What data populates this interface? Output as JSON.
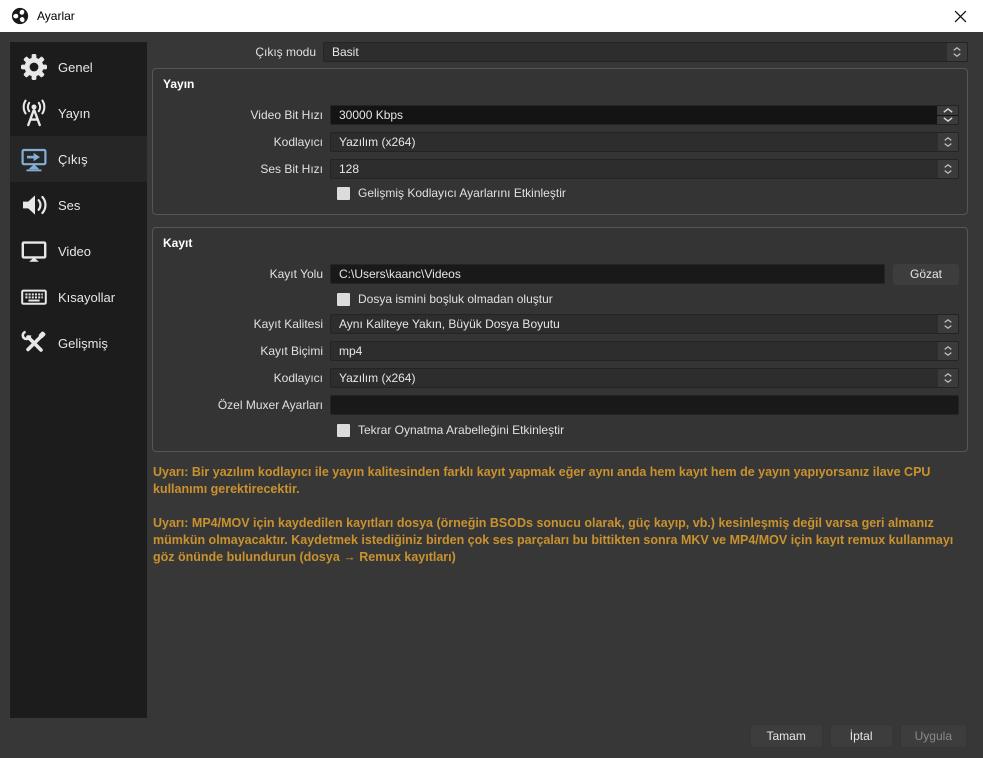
{
  "window": {
    "title": "Ayarlar"
  },
  "sidebar": {
    "items": [
      {
        "label": "Genel",
        "icon": "gear-icon"
      },
      {
        "label": "Yayın",
        "icon": "broadcast-icon"
      },
      {
        "label": "Çıkış",
        "icon": "output-icon",
        "selected": true
      },
      {
        "label": "Ses",
        "icon": "audio-icon"
      },
      {
        "label": "Video",
        "icon": "video-icon"
      },
      {
        "label": "Kısayollar",
        "icon": "keyboard-icon"
      },
      {
        "label": "Gelişmiş",
        "icon": "tools-icon"
      }
    ]
  },
  "output_mode": {
    "label": "Çıkış modu",
    "value": "Basit"
  },
  "streaming": {
    "title": "Yayın",
    "video_bitrate": {
      "label": "Video Bit Hızı",
      "value": "30000 Kbps"
    },
    "encoder": {
      "label": "Kodlayıcı",
      "value": "Yazılım (x264)"
    },
    "audio_bitrate": {
      "label": "Ses Bit Hızı",
      "value": "128"
    },
    "advanced_checkbox": "Gelişmiş Kodlayıcı Ayarlarını Etkinleştir"
  },
  "recording": {
    "title": "Kayıt",
    "path": {
      "label": "Kayıt Yolu",
      "value": "C:\\Users\\kaanc\\Videos",
      "browse": "Gözat"
    },
    "no_space_checkbox": "Dosya ismini boşluk olmadan oluştur",
    "quality": {
      "label": "Kayıt Kalitesi",
      "value": "Aynı Kaliteye Yakın, Büyük Dosya Boyutu"
    },
    "format": {
      "label": "Kayıt Biçimi",
      "value": "mp4"
    },
    "encoder": {
      "label": "Kodlayıcı",
      "value": "Yazılım (x264)"
    },
    "muxer": {
      "label": "Özel Muxer Ayarları",
      "value": ""
    },
    "replay_checkbox": "Tekrar Oynatma Arabelleğini Etkinleştir"
  },
  "warnings": [
    "Uyarı: Bir yazılım kodlayıcı ile yayın kalitesinden farklı kayıt yapmak eğer aynı anda hem kayıt hem de yayın yapıyorsanız ilave CPU kullanımı gerektirecektir.",
    "Uyarı: MP4/MOV için kaydedilen kayıtları dosya (örneğin BSODs sonucu olarak, güç kayıp, vb.) kesinleşmiş değil varsa geri almanız mümkün olmayacaktır. Kaydetmek istediğiniz birden çok ses parçaları bu bittikten sonra MKV ve MP4/MOV için kayıt remux kullanmayı göz önünde bulundurun (dosya → Remux kayıtları)"
  ],
  "footer": {
    "ok": "Tamam",
    "cancel": "İptal",
    "apply": "Uygula"
  },
  "colors": {
    "window_bg": "#373737",
    "sidebar_bg": "#1c1c1c",
    "selected_item_bg": "#262627",
    "accent_blue": "#85aed6",
    "warning_text": "#c9922e",
    "input_bg": "#191919",
    "combo_bg": "#2d2d2d",
    "titlebar_bg": "#ffffff"
  }
}
